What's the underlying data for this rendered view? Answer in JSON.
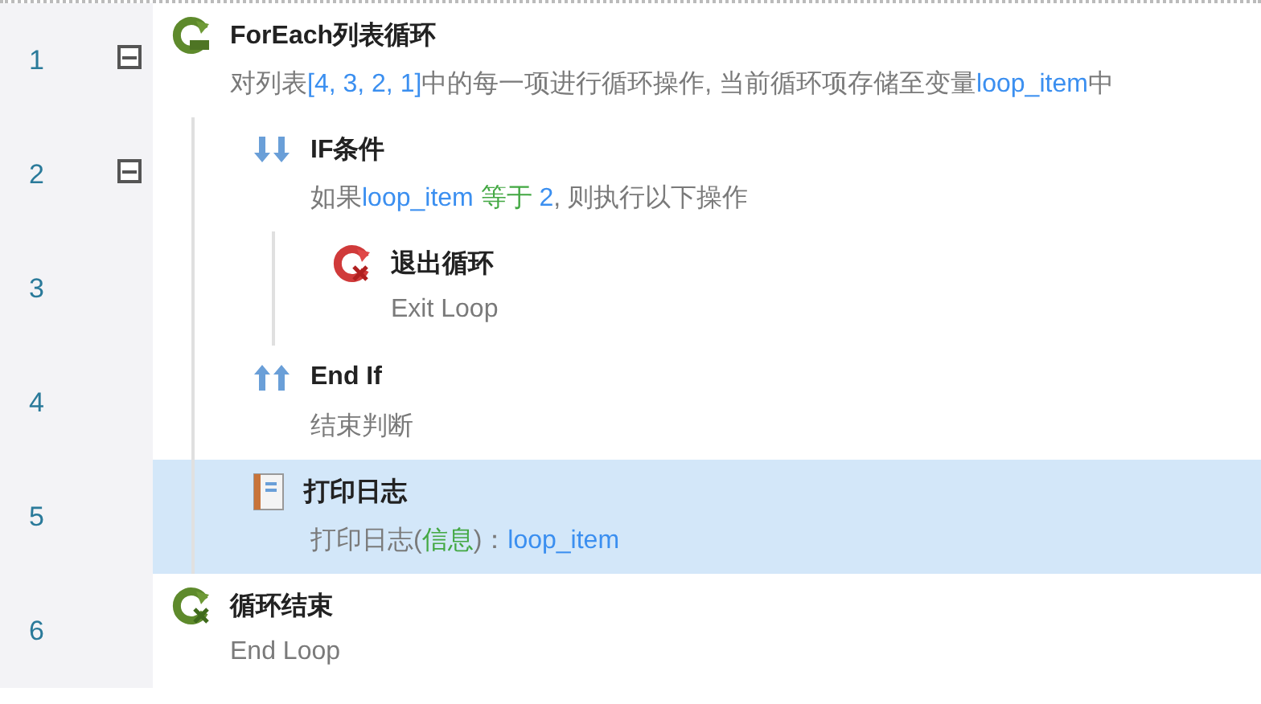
{
  "steps": [
    {
      "number": "1",
      "kind": "foreach",
      "title": "ForEach列表循环",
      "expanded": true,
      "selected": false,
      "description": [
        {
          "text": "对列表",
          "kind": "plain"
        },
        {
          "text": "[4, 3, 2, 1]",
          "kind": "value"
        },
        {
          "text": "中的每一项进行循环操作, 当前循环项存储至变量",
          "kind": "plain"
        },
        {
          "text": "loop_item",
          "kind": "value"
        },
        {
          "text": "中",
          "kind": "plain"
        }
      ],
      "children": [
        {
          "number": "2",
          "kind": "if",
          "title": "IF条件",
          "expanded": true,
          "selected": false,
          "description": [
            {
              "text": "如果",
              "kind": "plain"
            },
            {
              "text": "loop_item",
              "kind": "value"
            },
            {
              "text": " 等于 ",
              "kind": "operator"
            },
            {
              "text": "2",
              "kind": "value"
            },
            {
              "text": ", 则执行以下操作",
              "kind": "plain"
            }
          ],
          "children": [
            {
              "number": "3",
              "kind": "break",
              "title": "退出循环",
              "selected": false,
              "description": [
                {
                  "text": "Exit Loop",
                  "kind": "plain"
                }
              ]
            }
          ]
        },
        {
          "number": "4",
          "kind": "endif",
          "title": "End If",
          "selected": false,
          "description": [
            {
              "text": "结束判断",
              "kind": "plain"
            }
          ]
        },
        {
          "number": "5",
          "kind": "log",
          "title": "打印日志",
          "selected": true,
          "description": [
            {
              "text": "打印日志(",
              "kind": "plain"
            },
            {
              "text": "信息",
              "kind": "operator"
            },
            {
              "text": ")：",
              "kind": "plain"
            },
            {
              "text": "loop_item",
              "kind": "value"
            }
          ]
        }
      ]
    },
    {
      "number": "6",
      "kind": "endloop",
      "title": "循环结束",
      "selected": false,
      "description": [
        {
          "text": "End Loop",
          "kind": "plain"
        }
      ]
    }
  ]
}
